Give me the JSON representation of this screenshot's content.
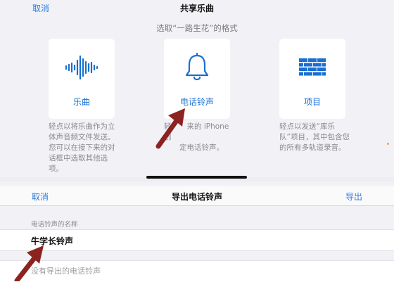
{
  "share_sheet": {
    "cancel_label": "取消",
    "title": "共享乐曲",
    "subtitle": "选取“一路生花”的格式",
    "options": [
      {
        "label": "乐曲",
        "icon": "waveform-icon",
        "description": "轻点以将乐曲作为立体声音频文件发送。您可以在接下来的对话框中选取其他选项。"
      },
      {
        "label": "电话铃声",
        "icon": "bell-icon",
        "description": "轻点以从 iPhone 创建自定电话铃声。"
      },
      {
        "label": "项目",
        "icon": "brick-wall-icon",
        "description": "轻点以发送“库乐队”项目，其中包含您的所有多轨道录音。"
      }
    ],
    "option2_desc_part1": "轻",
    "option2_desc_part2": "来的 iPhone 创",
    "option2_desc_line2": "定电话铃声。"
  },
  "export_sheet": {
    "cancel_label": "取消",
    "title": "导出电话铃声",
    "export_label": "导出",
    "name_caption": "电话铃声的名称",
    "name_value": "牛学长铃声",
    "empty_text": "没有导出的电话铃声"
  },
  "colors": {
    "accent": "#2f7bd9",
    "icon_blue": "#1a6fd1",
    "arrow": "#8b2420"
  }
}
